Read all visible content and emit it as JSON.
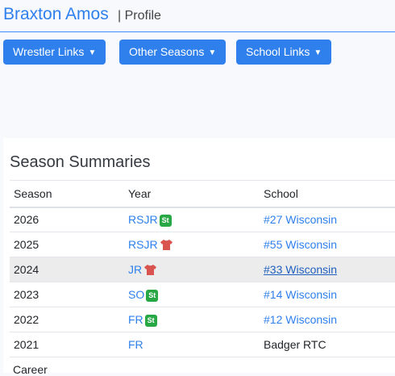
{
  "header": {
    "name": "Braxton Amos",
    "separator_sub": "| Profile"
  },
  "buttons": [
    {
      "label": "Wrestler Links"
    },
    {
      "label": "Other Seasons"
    },
    {
      "label": "School Links"
    }
  ],
  "season_summaries": {
    "title": "Season Summaries",
    "columns": [
      "Season",
      "Year",
      "School"
    ],
    "rows": [
      {
        "season": "2026",
        "year": "RSJR",
        "badge": "St",
        "school": "#27 Wisconsin"
      },
      {
        "season": "2025",
        "year": "RSJR",
        "badge": "shirt",
        "school": "#55 Wisconsin"
      },
      {
        "season": "2024",
        "year": "JR",
        "badge": "shirt",
        "school": "#33 Wisconsin"
      },
      {
        "season": "2023",
        "year": "SO",
        "badge": "St",
        "school": "#14 Wisconsin"
      },
      {
        "season": "2022",
        "year": "FR",
        "badge": "St",
        "school": "#12 Wisconsin"
      },
      {
        "season": "2021",
        "year": "FR",
        "badge": "",
        "school": "Badger RTC"
      }
    ],
    "footer_label": "Career"
  },
  "colors": {
    "accent": "#2f80ed",
    "badge_green": "#28a745",
    "shirt_red": "#d9534f"
  }
}
